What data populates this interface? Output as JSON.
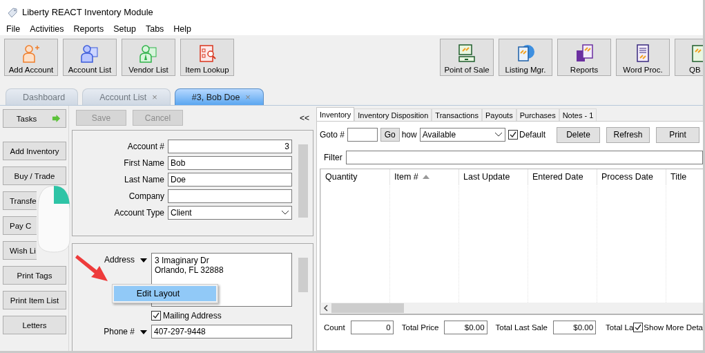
{
  "window": {
    "title": "Liberty REACT Inventory Module"
  },
  "menu": [
    "File",
    "Activities",
    "Reports",
    "Setup",
    "Tabs",
    "Help"
  ],
  "toolbar_left": [
    {
      "label": "Add Account"
    },
    {
      "label": "Account List"
    },
    {
      "label": "Vendor List"
    },
    {
      "label": "Item Lookup"
    }
  ],
  "toolbar_right": [
    {
      "label": "Point of Sale"
    },
    {
      "label": "Listing Mgr."
    },
    {
      "label": "Reports"
    },
    {
      "label": "Word Proc."
    },
    {
      "label": "QB"
    }
  ],
  "tabs": [
    {
      "label": "Dashboard",
      "selected": false,
      "closable": false
    },
    {
      "label": "Account List",
      "selected": false,
      "closable": true
    },
    {
      "label": "#3, Bob Doe",
      "selected": true,
      "closable": true
    }
  ],
  "close_mark": "×",
  "sidebar": {
    "tasks": "Tasks",
    "items": [
      "Add Inventory",
      "Buy / Trade",
      "Transfe",
      "Pay C",
      "Wish Li",
      "Print Tags",
      "Print Item List",
      "Letters"
    ]
  },
  "form": {
    "save": {
      "label": "Save",
      "disabled": true
    },
    "cancel": {
      "label": "Cancel",
      "disabled": true
    },
    "collapse": "<<",
    "fields": [
      {
        "label": "Account #",
        "value": "3",
        "kind": "number"
      },
      {
        "label": "First Name",
        "value": "Bob",
        "kind": "text"
      },
      {
        "label": "Last Name",
        "value": "Doe",
        "kind": "text"
      },
      {
        "label": "Company",
        "kind": "text"
      },
      {
        "label": "Account Type",
        "value": "Client",
        "kind": "select"
      }
    ]
  },
  "address_section": {
    "address_label": "Address",
    "address_lines": [
      "3 Imaginary Dr",
      "Orlando, FL  32888"
    ],
    "mailing": {
      "label": "Mailing Address",
      "checked": true
    },
    "phone_label": "Phone #",
    "phone": "407-297-9448"
  },
  "context_menu": {
    "items": [
      {
        "label": "Edit Layout",
        "selected": true
      }
    ]
  },
  "inventory": {
    "tabs": [
      {
        "label": "Inventory",
        "selected": true
      },
      {
        "label": "Inventory Disposition",
        "selected": false
      },
      {
        "label": "Transactions",
        "selected": false
      },
      {
        "label": "Payouts",
        "selected": false
      },
      {
        "label": "Purchases",
        "selected": false
      },
      {
        "label": "Notes - 1",
        "selected": false
      }
    ],
    "goto_label": "Goto #",
    "go": "Go",
    "show_label": "how",
    "show_value": "Available",
    "default": {
      "label": "Default",
      "checked": true
    },
    "buttons": [
      "Delete",
      "Refresh",
      "Print"
    ],
    "filter_label": "Filter",
    "columns": [
      {
        "label": "Quantity",
        "sorted": false
      },
      {
        "label": "Item #",
        "sorted": true
      },
      {
        "label": "Last Update",
        "sorted": false
      },
      {
        "label": "Entered Date",
        "sorted": false
      },
      {
        "label": "Process Date",
        "sorted": false
      },
      {
        "label": "Title",
        "sorted": false
      }
    ],
    "footer": [
      {
        "label": "Count",
        "value": "0"
      },
      {
        "label": "Total Price",
        "value": "$0.00"
      },
      {
        "label": "Total Last Sale",
        "value": "$0.00"
      }
    ],
    "footer_cut_label": "Total La",
    "show_more": {
      "label": "Show More Deta",
      "checked": true
    }
  }
}
